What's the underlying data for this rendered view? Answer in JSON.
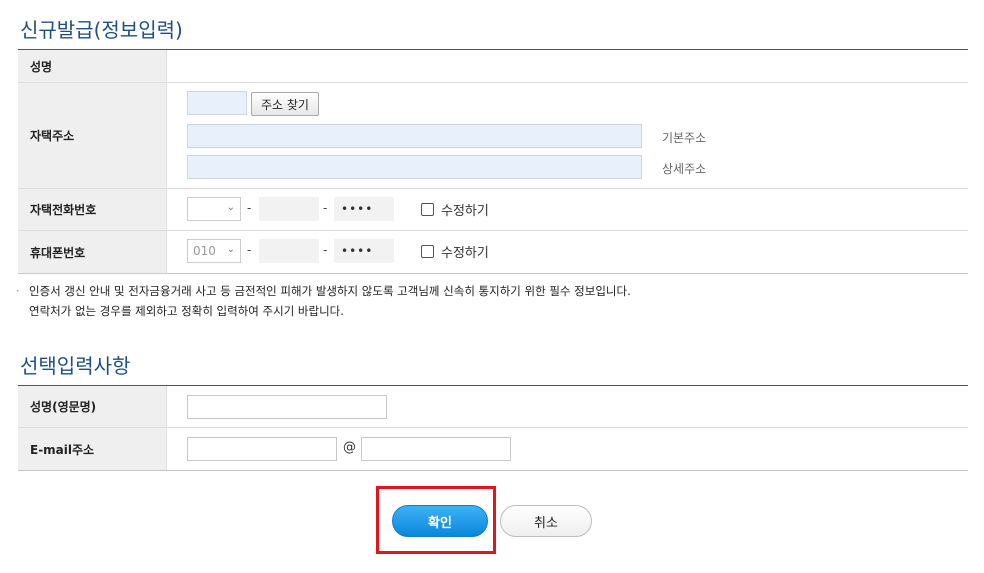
{
  "section1": {
    "title": "신규발급(정보입력)"
  },
  "rows": {
    "name": {
      "label": "성명"
    },
    "address": {
      "label": "자택주소",
      "find_button": "주소 찾기",
      "basic_hint": "기본주소",
      "detail_hint": "상세주소"
    },
    "home_phone": {
      "label": "자택전화번호",
      "area_value": "",
      "dash": "-",
      "masked": "••••",
      "edit_label": "수정하기"
    },
    "mobile": {
      "label": "휴대폰번호",
      "area_value": "010",
      "dash": "-",
      "masked": "••••",
      "edit_label": "수정하기"
    }
  },
  "notice": {
    "bullet": "·",
    "line1": "인증서 갱신 안내 및 전자금융거래 사고 등 금전적인 피해가 발생하지 않도록 고객님께 신속히 통지하기 위한 필수 정보입니다.",
    "line2": "연락처가 없는 경우를 제외하고 정확히 입력하여 주시기 바랍니다."
  },
  "section2": {
    "title": "선택입력사항"
  },
  "optional": {
    "eng_name": {
      "label": "성명(영문명)",
      "value": ""
    },
    "email": {
      "label": "E-mail주소",
      "at": "@",
      "user": "",
      "domain": ""
    }
  },
  "buttons": {
    "confirm": "확인",
    "cancel": "취소"
  },
  "colors": {
    "accent": "#1e4f86",
    "highlight": "#e3141c",
    "confirm": "#0a86dc"
  }
}
